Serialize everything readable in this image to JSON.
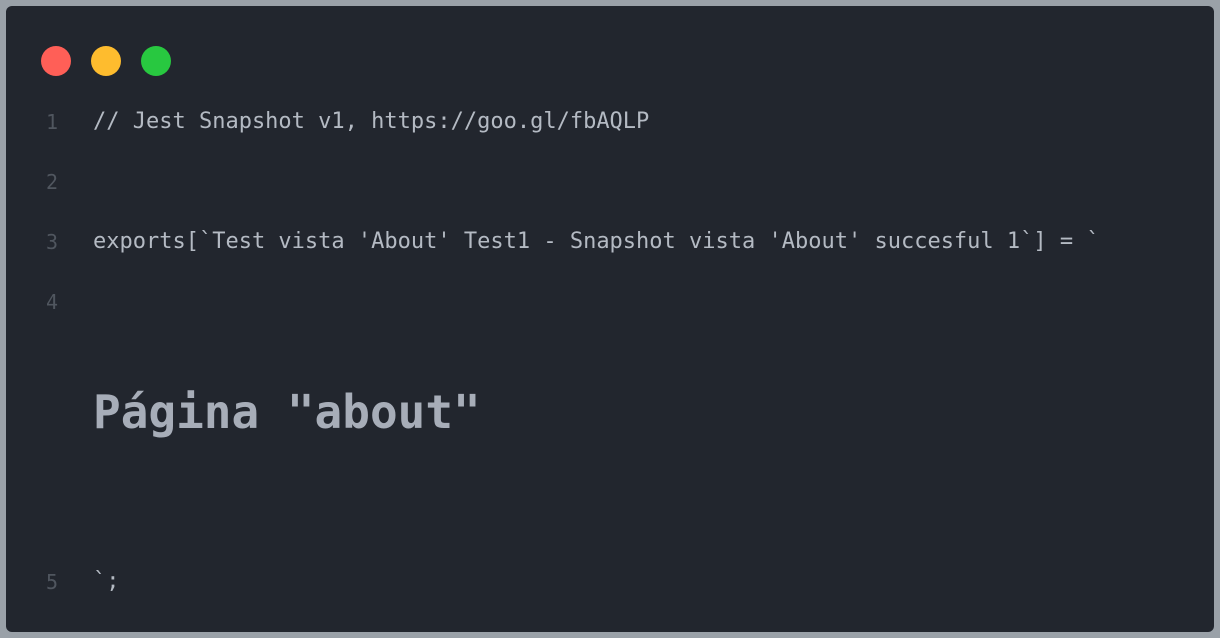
{
  "window": {
    "controls": [
      {
        "name": "close",
        "color": "#ff5f57"
      },
      {
        "name": "minimize",
        "color": "#febc2e"
      },
      {
        "name": "maximize",
        "color": "#28c840"
      }
    ]
  },
  "editor": {
    "line_numbers": [
      "1",
      "2",
      "3",
      "4",
      "5"
    ],
    "lines": [
      "// Jest Snapshot v1, https://goo.gl/fbAQLP",
      "",
      "exports[`Test vista 'About' Test1 - Snapshot vista 'About' succesful 1`] = `",
      "",
      "`;"
    ],
    "rendered_heading": "Página \"about\""
  }
}
